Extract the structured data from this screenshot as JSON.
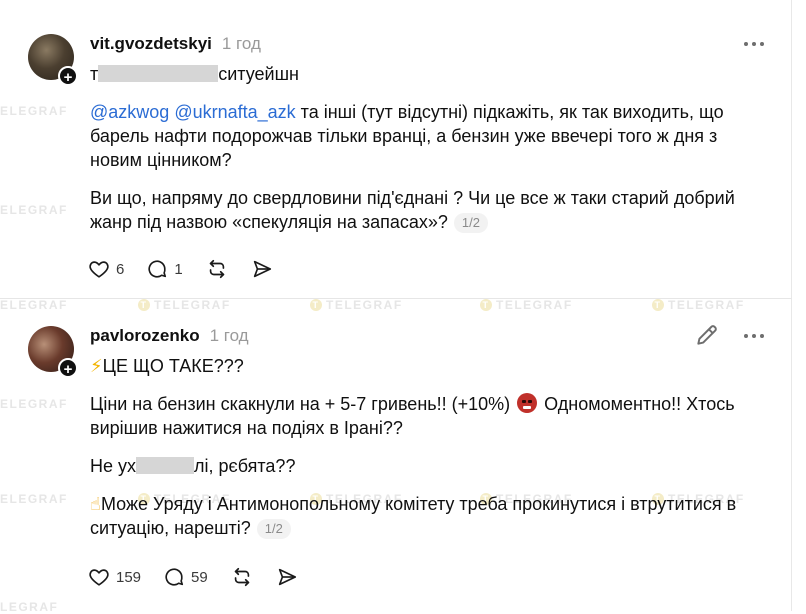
{
  "watermark": {
    "text": "TELEGRAF",
    "text_partial": "ELEGRAF",
    "text_cut": "LEGRAF"
  },
  "posts": [
    {
      "username": "vit.gvozdetskyi",
      "time": "1 год",
      "line1_pre": "т",
      "line1_post": "ситуейшн",
      "mention1": "@azkwog",
      "mention2": "@ukrnafta_azk",
      "para2_text": " та інші (тут відсутні) підкажіть, як так виходить, що барель нафти подорожчав тільки вранці, а бензин уже ввечері того ж дня з новим цінником?",
      "para3_text": "Ви що, напряму до свердловини під'єднані ? Чи це все ж таки старий добрий жанр під назвою «спекуляція на запасах»?",
      "pager": "1/2",
      "likes": "6",
      "replies": "1"
    },
    {
      "username": "pavlorozenko",
      "time": "1 год",
      "line1_text": "ЦЕ ЩО ТАКЕ???",
      "para2_pre": "Ціни на бензин скакнули на + 5-7 гривень!! (+10%) ",
      "para2_post": " Одномоментно!! Хтось вирішив нажитися на подіях в Ірані??",
      "para3_pre": "Не ух",
      "para3_post": "лі, рєбята??",
      "para4_text": "Може Уряду і Антимонопольному комітету треба прокинутися і втрутитися в ситуацію, нарешті?",
      "pager": "1/2",
      "likes": "159",
      "replies": "59"
    }
  ],
  "icons": {
    "like": "heart-icon",
    "reply": "comment-icon",
    "repost": "repost-icon",
    "share": "send-icon",
    "more": "more-dots-icon",
    "edit": "pencil-icon",
    "follow": "plus-icon"
  },
  "colors": {
    "mention": "#2b6cd4",
    "muted": "#9a9a9a",
    "text": "#101010"
  }
}
